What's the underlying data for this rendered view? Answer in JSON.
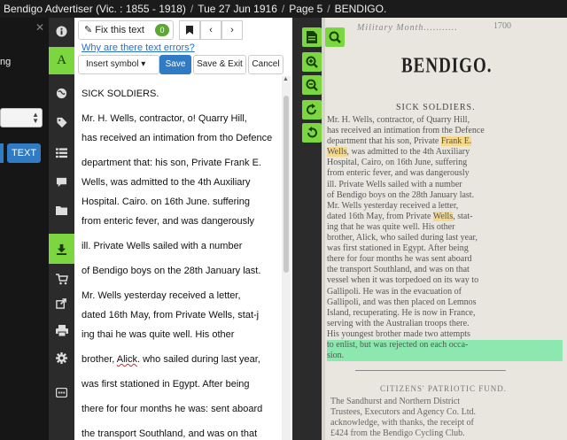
{
  "breadcrumb": {
    "source": "Bendigo Advertiser (Vic. : 1855 - 1918)",
    "date": "Tue 27 Jun 1916",
    "page": "Page 5",
    "article": "BENDIGO."
  },
  "left_panel": {
    "partial_label": "ng",
    "text_button": "TEXT"
  },
  "iconbar": {
    "items": [
      "info-icon",
      "text-a-icon",
      "globe-icon",
      "tags-icon",
      "list-icon",
      "comment-icon",
      "folder-icon",
      "download-icon",
      "cart-icon",
      "share-icon",
      "print-icon",
      "gear-icon",
      "embed-icon"
    ],
    "text_letter": "A"
  },
  "editor": {
    "fix_button": "✎ Fix this text",
    "fix_count": "0",
    "why_link": "Why are there text errors?",
    "insert_symbol": "Insert symbol ▾",
    "save": "Save",
    "save_exit": "Save & Exit",
    "cancel": "Cancel",
    "lines": [
      "SICK SOLDIERS.",
      "Mr. H. Wells, contractor, o! Quarry Hill,",
      "has received an intimation from tho Defence",
      "department that: his son, Private Frank E.",
      "Wells, was admitted to the 4th Auxiliary",
      "Hospital. Cairo. on 16th June. suffering",
      "from enteric fever, and was dangerously",
      "ill. Private Wells sailed with a number",
      "of Bendigo boys on the 28th January last.",
      "Mr. Wells yesterday received a letter,",
      "dated 16th May, from Private Wells, stat-j",
      "ing thai he was quite well. His other",
      "brother, Alick. who sailed during last year,",
      "was first stationed in Egypt. After being",
      "there for four months he was: sent aboard",
      "the transport Southland, and was on that"
    ]
  },
  "viewer": {
    "tools": [
      "page-icon",
      "zoom-fit-icon",
      "zoom-in-icon",
      "zoom-out-icon",
      "rotate-cw-icon",
      "rotate-ccw-icon"
    ],
    "masthead": "Military Month...........",
    "page_number": "1700",
    "title": "BENDIGO.",
    "heading": "SICK SOLDIERS.",
    "paragraph_lines": [
      "Mr. H. Wells, contractor, of Quarry Hill,",
      "has received an intimation from the Defence",
      "department that his son, Private Frank E.",
      "Wells, was admitted to the 4th Auxiliary",
      "Hospital, Cairo, on 16th June, suffering",
      "from enteric fever, and was dangerously",
      "ill. Private Wells sailed with a number",
      "of Bendigo boys on the 28th January last.",
      "Mr. Wells yesterday received a letter,",
      "dated 16th May, from Private Wells, stat-",
      "ing that he was quite well. His other",
      "brother, Alick, who sailed during last year,",
      "was first stationed in Egypt. After being",
      "there for four months he was sent aboard",
      "the transport Southland, and was on that",
      "vessel when it was torpedoed on its way to",
      "Gallipoli. He was in the evacuation of",
      "Gallipoli, and was then placed on Lemnos",
      "Island, recuperating. He is now in France,",
      "serving with the Australian troops there.",
      "His youngest brother made two attempts",
      "to enlist, but was rejected on each occa-",
      "sion."
    ],
    "sub_heading": "CITIZENS' PATRIOTIC FUND.",
    "lower_lines": [
      "The Sandhurst and Northern District",
      "Trustees, Executors and Agency Co. Ltd.",
      "acknowledge, with thanks, the receipt of",
      "£424 from the Bendigo Cycling Club."
    ]
  }
}
